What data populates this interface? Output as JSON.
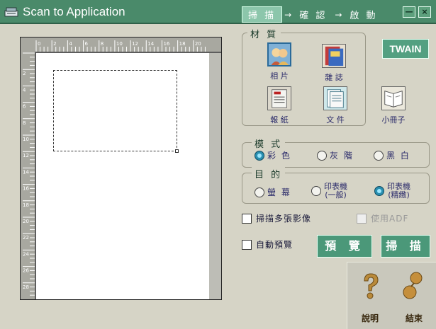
{
  "window": {
    "title": "Scan to Application",
    "steps": [
      "掃 描",
      "確 認",
      "啟 動"
    ],
    "arrow": "→",
    "minimize": "—",
    "close": "×"
  },
  "material": {
    "label": "材 質",
    "items": [
      {
        "label": "相 片",
        "selected": true
      },
      {
        "label": "雜 誌",
        "selected": false
      },
      {
        "label": "報 紙",
        "selected": false
      },
      {
        "label": "文 件",
        "selected": false
      },
      {
        "label": "小冊子",
        "selected": false
      }
    ]
  },
  "twain": "TWAIN",
  "mode": {
    "label": "模 式",
    "options": [
      "彩 色",
      "灰 階",
      "黑 白"
    ],
    "selected": "彩 色"
  },
  "destination": {
    "label": "目 的",
    "options": [
      "螢 幕",
      "印表機 (一般)",
      "印表機 (精緻)"
    ],
    "opt2_line1": "印表機",
    "opt2_line2": "(一般)",
    "opt3_line1": "印表機",
    "opt3_line2": "(精緻)",
    "selected": "印表機 (精緻)"
  },
  "options": {
    "multi_scan": "掃描多張影像",
    "use_adf": "使用ADF",
    "auto_preview": "自動預覽"
  },
  "buttons": {
    "preview": "預 覽",
    "scan": "掃 描"
  },
  "help": {
    "help_label": "說明",
    "exit_label": "結束"
  },
  "ruler": {
    "top_ticks": [
      "0",
      "2",
      "4",
      "6",
      "8",
      "10",
      "12",
      "14",
      "16",
      "18",
      "20"
    ],
    "left_ticks": [
      "2",
      "4",
      "6",
      "8",
      "10",
      "12",
      "14",
      "16",
      "18",
      "20",
      "22",
      "24",
      "26",
      "28"
    ]
  },
  "colors": {
    "titlebar": "#4a8a6a",
    "accent": "#4b9879",
    "background": "#d6d4c6"
  }
}
